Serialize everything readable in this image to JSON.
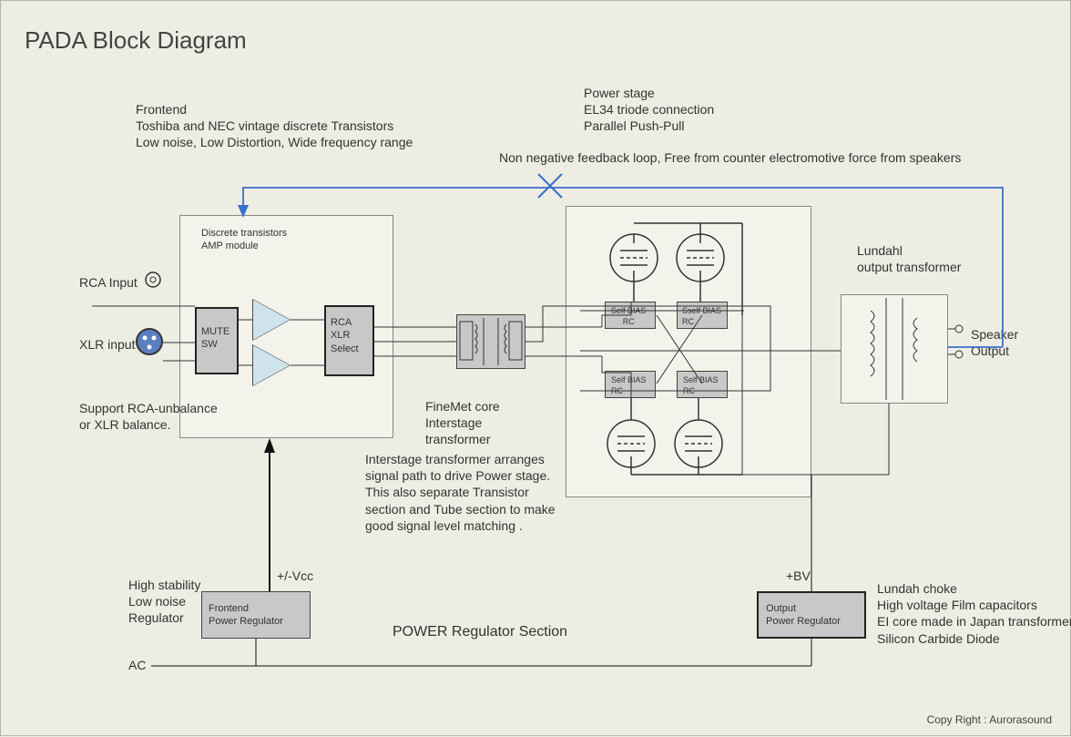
{
  "title": "PADA Block Diagram",
  "frontend": {
    "heading": "Frontend",
    "line1": "Toshiba and NEC vintage discrete Transistors",
    "line2": "Low noise, Low Distortion, Wide frequency range"
  },
  "power_stage": {
    "heading": "Power stage",
    "line1": "EL34 triode connection",
    "line2": "Parallel Push-Pull"
  },
  "nfb_note": "Non negative feedback loop, Free from counter electromotive force from speakers",
  "amp_module_label": "Discrete transistors\nAMP module",
  "rca_input": "RCA Input",
  "xlr_input": "XLR input",
  "support_note": "Support RCA-unbalance\nor XLR balance.",
  "mute_sw": "MUTE\nSW",
  "rca_xlr_select": "RCA\nXLR\nSelect",
  "interstage": {
    "heading": "FineMet core\nInterstage\ntransformer",
    "desc": "Interstage transformer arranges signal path to drive Power stage.\nThis also separate Transistor section and Tube section to make good signal level matching ."
  },
  "self_bias_labels": [
    "Self BIAS\nRC",
    "Sself BIAS\nRC",
    "Self BIAS\nRC",
    "Self BIAS\nRC"
  ],
  "lundahl_label": "Lundahl\noutput transformer",
  "speaker_output": "Speaker\nOutput",
  "vcc": "+/-Vcc",
  "bv": "+BV",
  "frontend_reg": "Frontend\nPower Regulator",
  "output_reg": "Output\nPower Regulator",
  "power_section": "POWER Regulator Section",
  "regulator_note": "High stability\nLow noise\nRegulator",
  "output_reg_note": "Lundah choke\nHigh voltage Film capacitors\nEI core made in Japan transformer\nSilicon Carbide Diode",
  "ac": "AC",
  "copyright": "Copy Right : Aurorasound"
}
